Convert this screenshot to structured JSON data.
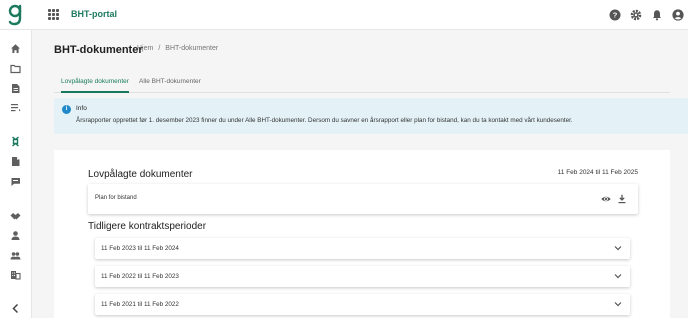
{
  "app": {
    "logo_letter": "g",
    "title": "BHT-portal"
  },
  "topbar_icons": [
    "help-icon",
    "settings-icon",
    "notifications-icon",
    "account-icon"
  ],
  "sidebar": {
    "items": [
      "home-icon",
      "folder-icon",
      "document-icon",
      "list-icon",
      "bht-icon",
      "file-icon",
      "chat-icon",
      "handshake-icon",
      "person-icon",
      "group-icon",
      "company-icon"
    ],
    "collapse_icon": "chevron-left-icon"
  },
  "header": {
    "title": "BHT-dokumenter",
    "breadcrumb": [
      "Hjem",
      "/",
      "BHT-dokumenter"
    ]
  },
  "tabs": [
    {
      "label": "Lovpålagte dokumenter",
      "active": true
    },
    {
      "label": "Alle BHT-dokumenter",
      "active": false
    }
  ],
  "info": {
    "title": "Info",
    "text": "Årsrapporter opprettet før 1. desember 2023 finner du under Alle BHT-dokumenter. Dersom du savner en årsrapport eller plan for bistand, kan du ta kontakt med vårt kundesenter."
  },
  "main": {
    "section_title": "Lovpålagte dokumenter",
    "current_period": "11 Feb 2024 til 11 Feb 2025",
    "document": {
      "label": "Plan for bistand"
    },
    "previous_title": "Tidligere kontraktsperioder",
    "previous_periods": [
      "11 Feb 2023 til 11 Feb 2024",
      "11 Feb 2022 til 11 Feb 2023",
      "11 Feb 2021 til 11 Feb 2022"
    ]
  },
  "colors": {
    "brand": "#1b7a5e",
    "info_bg": "#e4f2f8",
    "info_icon": "#1e88c8"
  }
}
